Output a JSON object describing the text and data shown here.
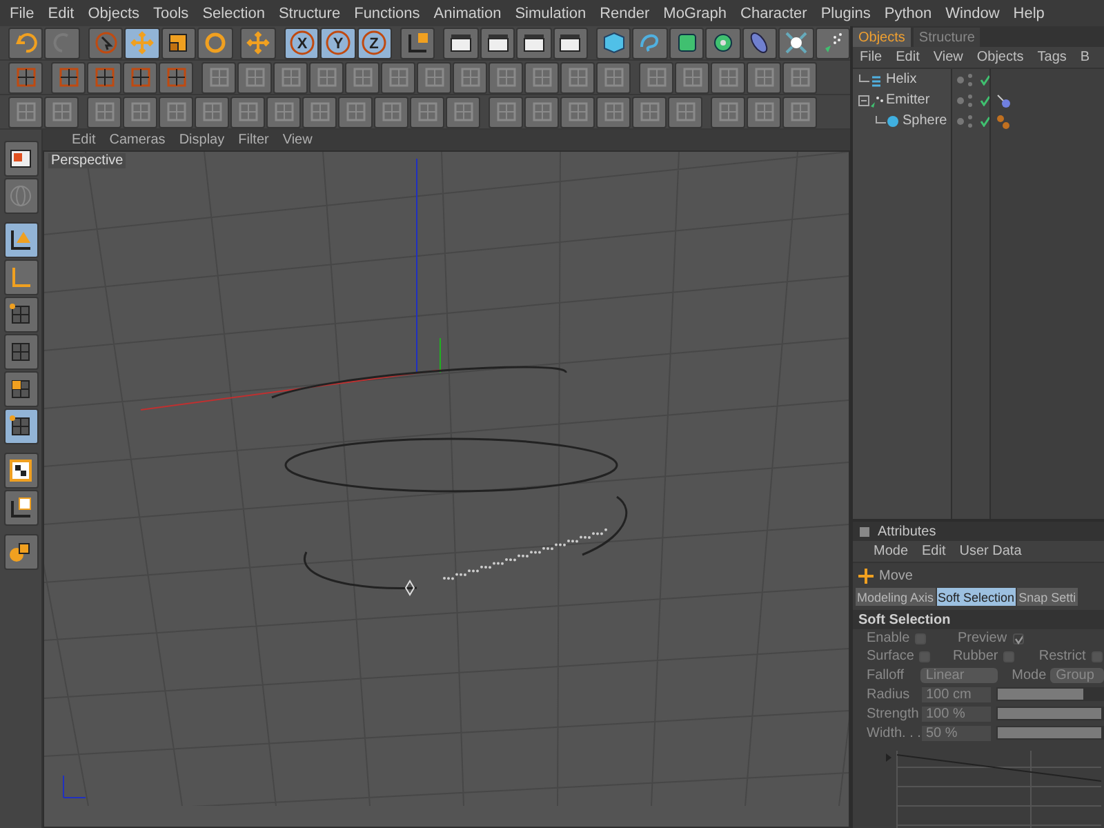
{
  "menu": [
    "File",
    "Edit",
    "Objects",
    "Tools",
    "Selection",
    "Structure",
    "Functions",
    "Animation",
    "Simulation",
    "Render",
    "MoGraph",
    "Character",
    "Plugins",
    "Python",
    "Window",
    "Help"
  ],
  "toolbar": [
    {
      "kind": "undo",
      "selected": false
    },
    {
      "kind": "redo",
      "selected": false
    },
    {
      "kind": "select",
      "selected": false
    },
    {
      "kind": "move",
      "selected": true
    },
    {
      "kind": "scale",
      "selected": false
    },
    {
      "kind": "rotate",
      "selected": false
    },
    {
      "kind": "add",
      "selected": false
    },
    {
      "kind": "axis",
      "label": "X",
      "selected": true
    },
    {
      "kind": "axis",
      "label": "Y",
      "selected": true
    },
    {
      "kind": "axis",
      "label": "Z",
      "selected": true
    },
    {
      "kind": "coords",
      "selected": false
    },
    {
      "kind": "render",
      "selected": false
    },
    {
      "kind": "render",
      "selected": false
    },
    {
      "kind": "render",
      "selected": false
    },
    {
      "kind": "render",
      "selected": false
    },
    {
      "kind": "cube",
      "selected": false
    },
    {
      "kind": "spline",
      "selected": false
    },
    {
      "kind": "nurbs",
      "selected": false
    },
    {
      "kind": "array",
      "selected": false
    },
    {
      "kind": "deformer",
      "selected": false
    },
    {
      "kind": "scene",
      "selected": false
    },
    {
      "kind": "particles",
      "selected": false
    }
  ],
  "side_toolbar": [
    {
      "kind": "layout",
      "selected": false
    },
    {
      "kind": "sphere",
      "selected": false
    },
    {
      "kind": "axis-model",
      "selected": true
    },
    {
      "kind": "axis-object",
      "selected": false
    },
    {
      "kind": "points",
      "selected": false
    },
    {
      "kind": "edges",
      "selected": false
    },
    {
      "kind": "polygons",
      "selected": false
    },
    {
      "kind": "uv",
      "selected": true
    },
    {
      "kind": "texture",
      "selected": false
    },
    {
      "kind": "texture-axis",
      "selected": false
    },
    {
      "kind": "workplane",
      "selected": false
    }
  ],
  "viewport": {
    "menu": [
      "Edit",
      "Cameras",
      "Display",
      "Filter",
      "View"
    ],
    "label": "Perspective"
  },
  "objects": {
    "tabs": [
      {
        "label": "Objects",
        "selected": true
      },
      {
        "label": "Structure",
        "selected": false
      }
    ],
    "menu": [
      "File",
      "Edit",
      "View",
      "Objects",
      "Tags",
      "B"
    ],
    "tree": [
      {
        "name": "Helix",
        "kind": "helix"
      },
      {
        "name": "Emitter",
        "kind": "emitter",
        "expanded": true,
        "tags": [
          {
            "kind": "emitter"
          }
        ],
        "children": [
          {
            "name": "Sphere",
            "kind": "sphere",
            "tags": [
              {
                "kind": "material"
              }
            ]
          }
        ]
      }
    ]
  },
  "attributes": {
    "title": "Attributes",
    "menu": [
      "Mode",
      "Edit",
      "User Data"
    ],
    "tool": "Move",
    "tabs": [
      {
        "label": "Modeling Axis",
        "selected": false
      },
      {
        "label": "Soft Selection",
        "selected": true
      },
      {
        "label": "Snap Setti",
        "selected": false
      }
    ],
    "section": "Soft Selection",
    "checks": [
      [
        {
          "label": "Enable",
          "checked": false
        },
        {
          "label": "Preview",
          "checked": true
        }
      ],
      [
        {
          "label": "Surface",
          "checked": false
        },
        {
          "label": "Rubber",
          "checked": false
        },
        {
          "label": "Restrict",
          "checked": false
        }
      ]
    ],
    "falloff": {
      "label": "Falloff",
      "value": "Linear"
    },
    "mode": {
      "label": "Mode",
      "value": "Group"
    },
    "fields": [
      {
        "label": "Radius",
        "value": "100 cm",
        "level": 0.83
      },
      {
        "label": "Strength",
        "value": "100 %",
        "level": 1
      },
      {
        "label": "Width. . .",
        "value": "50 %",
        "level": 1
      }
    ]
  }
}
